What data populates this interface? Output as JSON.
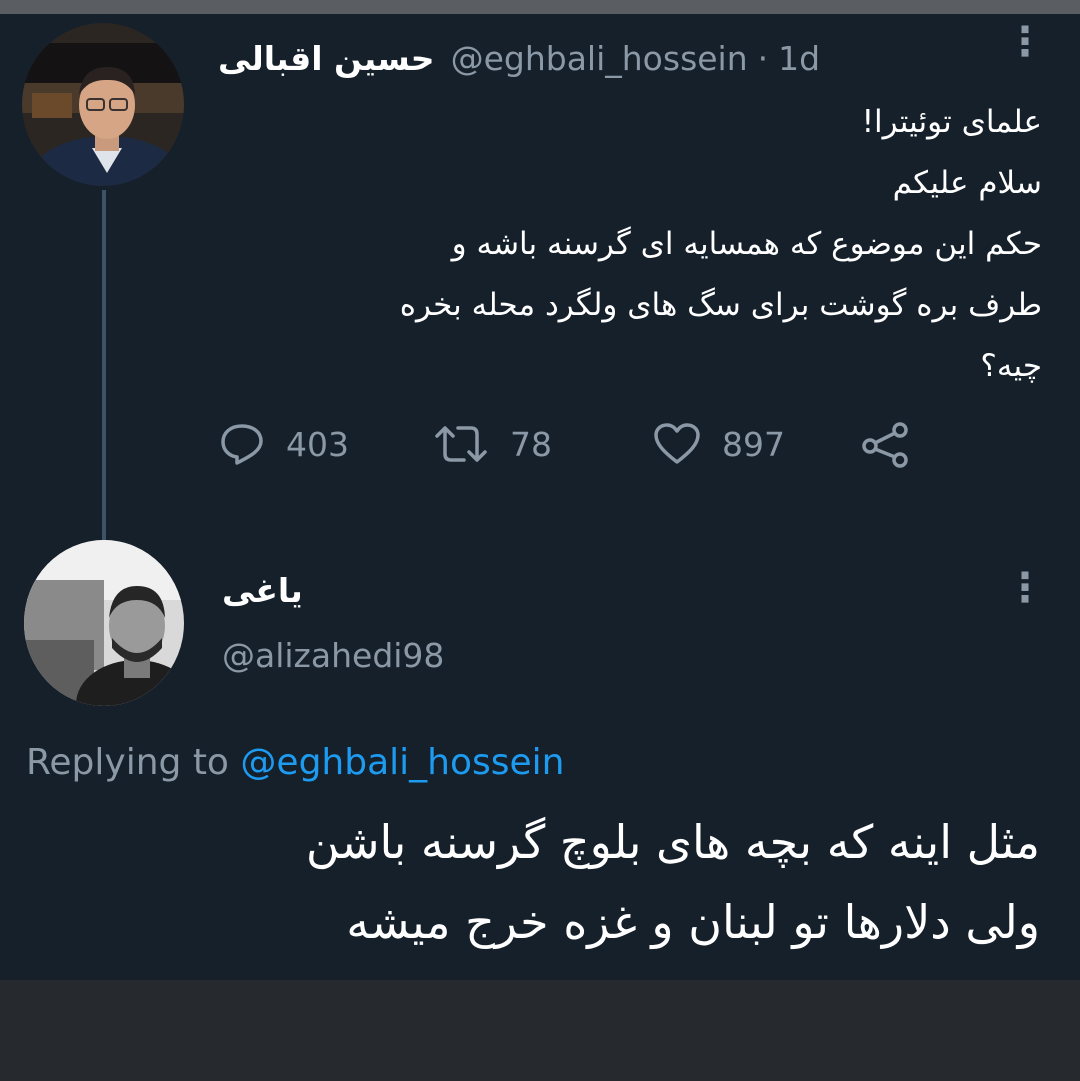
{
  "tweet": {
    "display_name": "حسین اقبالی",
    "handle": "@eghbali_hossein",
    "separator": "·",
    "time": "1d",
    "body_lines": [
      "علمای توئیترا!",
      "سلام علیکم",
      "حکم این موضوع که همسایه ای گرسنه باشه و",
      "طرف بره گوشت برای سگ های ولگرد محله  بخره",
      "چیه؟"
    ],
    "replies": "403",
    "retweets": "78",
    "likes": "897",
    "more_icon": "⋮"
  },
  "reply": {
    "display_name": "یاغی",
    "handle": "@alizahedi98",
    "replying_label": "Replying to",
    "replying_handle": "@eghbali_hossein",
    "body_lines": [
      "مثل اینه که بچه های بلوچ گرسنه باشن",
      "ولی دلارها تو لبنان و غزه خرج میشه"
    ],
    "more_icon": "⋮"
  },
  "icons": {
    "reply": "reply-icon",
    "retweet": "retweet-icon",
    "like": "heart-icon",
    "share": "share-icon"
  },
  "colors": {
    "background": "#15202b",
    "text": "#e7e9ea",
    "muted": "#8b98a5",
    "link": "#1d9bf0",
    "thread_line": "#3d5466"
  }
}
